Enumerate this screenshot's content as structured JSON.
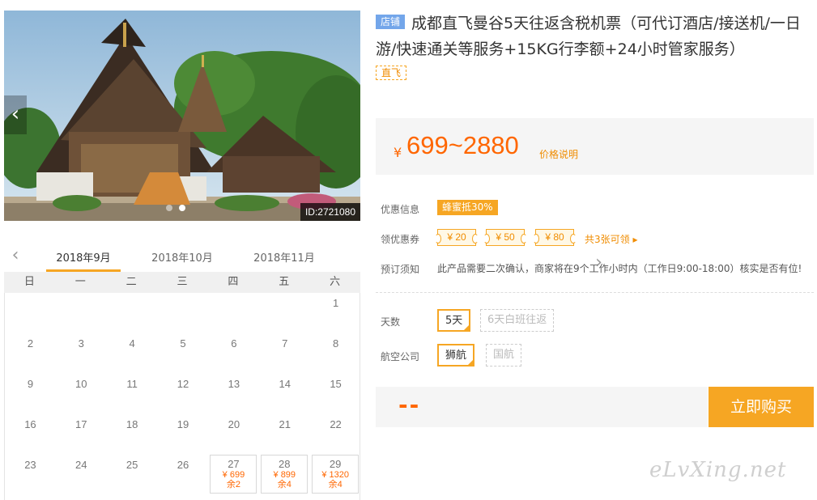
{
  "gallery": {
    "prev_arrow": "‹",
    "next_arrow": "›",
    "id_label": "ID:2721080"
  },
  "calendar": {
    "prev_arrow": "‹",
    "next_arrow": "›",
    "months": [
      "2018年9月",
      "2018年10月",
      "2018年11月"
    ],
    "active_month_index": 0,
    "weekdays": [
      "日",
      "一",
      "二",
      "三",
      "四",
      "五",
      "六"
    ],
    "first_weekday_index": 6,
    "days_in_month": 29,
    "available": {
      "27": {
        "price": "¥ 699",
        "left": "余2"
      },
      "28": {
        "price": "¥ 899",
        "left": "余4"
      },
      "29": {
        "price": "¥ 1320",
        "left": "余4"
      }
    }
  },
  "product": {
    "shop_badge": "店铺",
    "title": "成都直飞曼谷5天往返含税机票（可代订酒店/接送机/一日游/快速通关等服务+15KG行李额+24小时管家服务）",
    "tag": "直飞",
    "price_currency": "¥",
    "price_range": "699~2880",
    "price_explain": "价格说明"
  },
  "promo": {
    "label": "优惠信息",
    "badge": "蜂蜜抵30%"
  },
  "coupons": {
    "label": "领优惠券",
    "items": [
      "¥ 20",
      "¥ 50",
      "¥ 80"
    ],
    "link": "共3张可领 ▸"
  },
  "booking_notice": {
    "label": "预订须知",
    "text": "此产品需要二次确认，商家将在9个工作小时内（工作日9:00-18:00）核实是否有位!"
  },
  "options": {
    "days_label": "天数",
    "days": [
      "5天",
      "6天白班往返"
    ],
    "airline_label": "航空公司",
    "airlines": [
      "狮航",
      "国航"
    ]
  },
  "purchase": {
    "price_placeholder": "--",
    "buy_label": "立即购买"
  },
  "watermark": "eLvXing.net"
}
